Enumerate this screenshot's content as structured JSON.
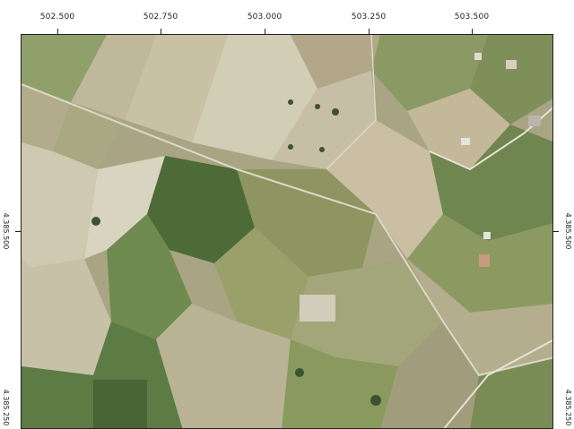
{
  "map": {
    "x_ticks": [
      "502.500",
      "502.750",
      "503.000",
      "503.250",
      "503.500"
    ],
    "y_ticks_left": [
      "4.385.500",
      "4.385.250"
    ],
    "y_ticks_right": [
      "4.385.500",
      "4.385.250"
    ]
  },
  "colors": {
    "field_light": "#c9c2a8",
    "field_tan": "#b8ad8e",
    "field_pale": "#d6d2bf",
    "field_green": "#5f7a45",
    "field_dark_green": "#3f5a30",
    "field_olive": "#8a8c5a",
    "road": "#e4e0d4",
    "frame": "#222222"
  }
}
